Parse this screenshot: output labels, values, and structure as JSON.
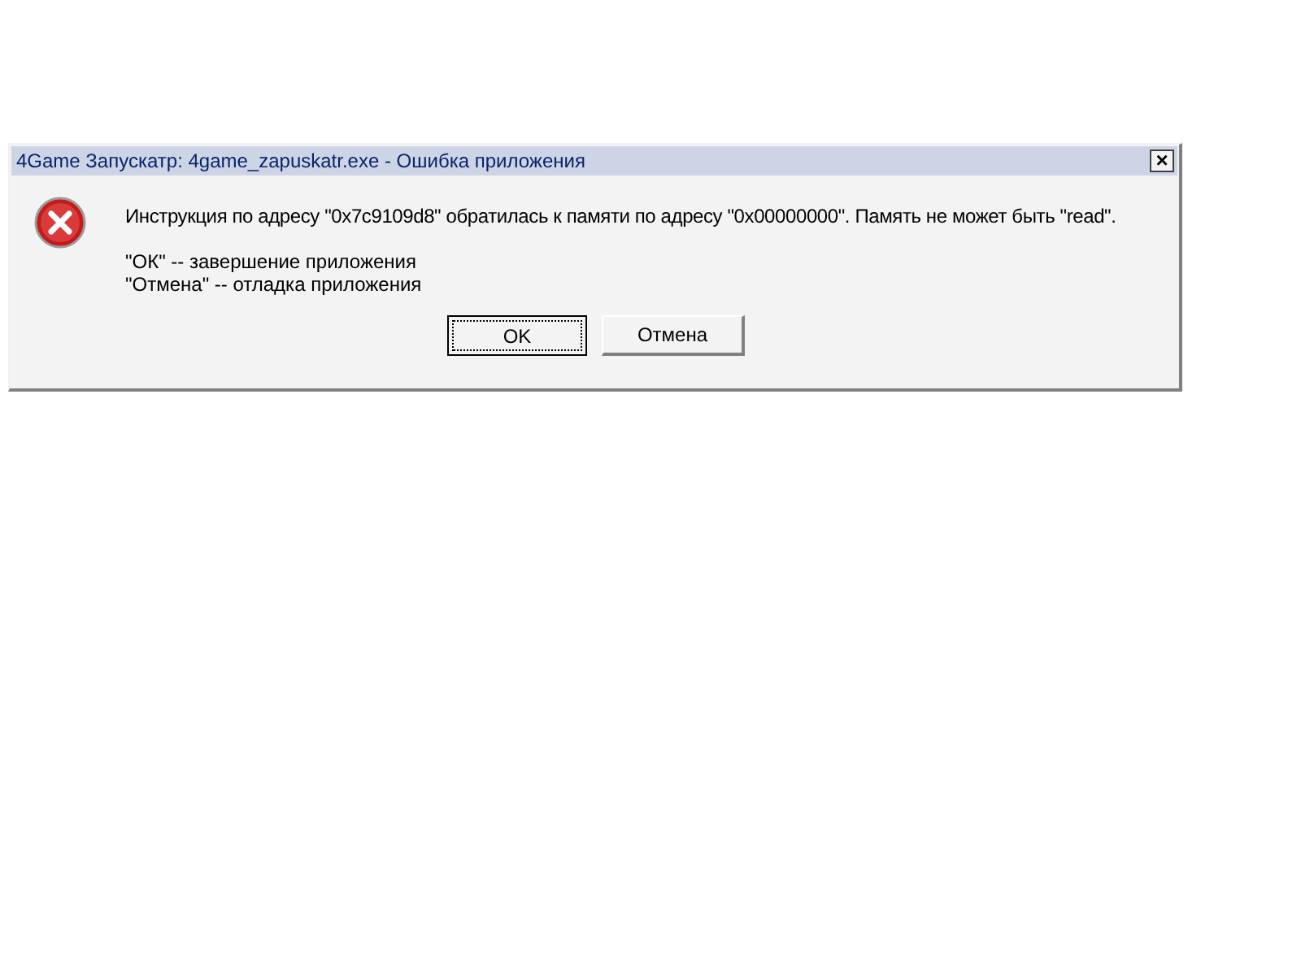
{
  "window": {
    "title": "4Game Запускатр: 4game_zapuskatr.exe - Ошибка приложения",
    "close": "×"
  },
  "message": "Инструкция по адресу \"0x7c9109d8\" обратилась к памяти по адресу \"0x00000000\". Память не может быть \"read\".",
  "notes": [
    "\"ОК\" -- завершение приложения",
    "\"Отмена\" -- отладка приложения"
  ],
  "buttons": [
    {
      "label": "OK",
      "default": true
    },
    {
      "label": "Отмена",
      "default": false
    }
  ]
}
